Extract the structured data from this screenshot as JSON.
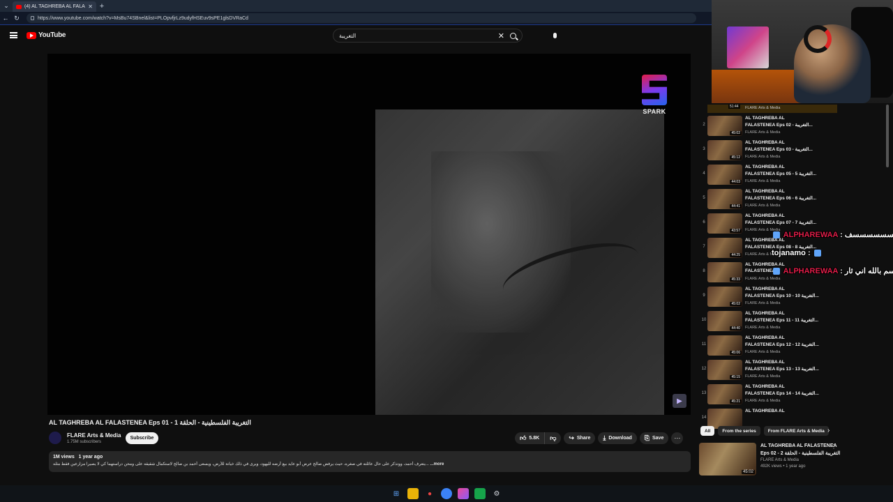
{
  "browser": {
    "tab_title": "(4) AL TAGHREBA AL FALASTENEA",
    "url": "https://www.youtube.com/watch?v=MsBu74SBnel&list=PLOpvfjrLz9udyfHSEuv9sPE1glsDVRaCd"
  },
  "header": {
    "brand": "YouTube",
    "search_query": "التغريبة"
  },
  "video": {
    "spark_label": "SPARK",
    "title": "AL TAGHREBA AL FALASTENEA Eps 01 - التغريبة الفلسطينية - الحلقة 1",
    "channel": "FLARE Arts & Media",
    "subscribers": "1.75M subscribers",
    "subscribe_label": "Subscribe",
    "likes": "5.8K",
    "share_label": "Share",
    "download_label": "Download",
    "save_label": "Save",
    "views": "1M views",
    "age": "1 year ago",
    "description": "يتعرف أحمد، ووتذكر على حال عائلته في صغره، حيث يرفض صالح عرض أبو عايد بيع أرضه لليهود، ويرى في ذلك خيانة للأرض، ويسعى أحمد بن صالح لاستكمال شقيقه على ومحن دراستهما كي لا يصيرا مزارعين فقط مثله...",
    "more_label": "...more"
  },
  "playlist": {
    "current_duration": "51:44",
    "current_channel": "FLARE Arts & Media",
    "items": [
      {
        "index": "2",
        "title1": "AL TAGHREBA AL",
        "title2": "FALASTENEA Eps 02 - التغريبة...",
        "channel": "FLARE Arts & Media",
        "duration": "45:02"
      },
      {
        "index": "3",
        "title1": "AL TAGHREBA AL",
        "title2": "FALASTENEA Eps 03 - التغريبة...",
        "channel": "FLARE Arts & Media",
        "duration": "45:12"
      },
      {
        "index": "4",
        "title1": "AL TAGHREBA AL",
        "title2": "FALASTENEA Eps 05 - 5 التغريبة...",
        "channel": "FLARE Arts & Media",
        "duration": "44:03"
      },
      {
        "index": "5",
        "title1": "AL TAGHREBA AL",
        "title2": "FALASTENEA Eps 06 - 6 التغريبة...",
        "channel": "FLARE Arts & Media",
        "duration": "44:41"
      },
      {
        "index": "6",
        "title1": "AL TAGHREBA AL",
        "title2": "FALASTENEA Eps 07 - 7 التغريبة...",
        "channel": "FLARE Arts & Media",
        "duration": "43:57"
      },
      {
        "index": "7",
        "title1": "AL TAGHREBA AL",
        "title2": "FALASTENEA Eps 08 - 8 التغريبة...",
        "channel": "FLARE Arts & Media",
        "duration": "44:25"
      },
      {
        "index": "8",
        "title1": "AL TAGHREBA AL",
        "title2": "FALASTENEA",
        "channel": "FLARE Arts & Media",
        "duration": "45:33"
      },
      {
        "index": "9",
        "title1": "AL TAGHREBA AL",
        "title2": "FALASTENEA Eps 10 - 10 التغريبة...",
        "channel": "FLARE Arts & Media",
        "duration": "45:02"
      },
      {
        "index": "10",
        "title1": "AL TAGHREBA AL",
        "title2": "FALASTENEA Eps 11 - 11 التغريبة...",
        "channel": "FLARE Arts & Media",
        "duration": "44:40"
      },
      {
        "index": "11",
        "title1": "AL TAGHREBA AL",
        "title2": "FALASTENEA Eps 12 - 12 التغريبة...",
        "channel": "FLARE Arts & Media",
        "duration": "45:06"
      },
      {
        "index": "12",
        "title1": "AL TAGHREBA AL",
        "title2": "FALASTENEA Eps 13 - 13 التغريبة...",
        "channel": "FLARE Arts & Media",
        "duration": "45:15"
      },
      {
        "index": "13",
        "title1": "AL TAGHREBA AL",
        "title2": "FALASTENEA Eps 14 - 14 التغريبة...",
        "channel": "FLARE Arts & Media",
        "duration": "45:21"
      },
      {
        "index": "14",
        "title1": "AL TAGHREBA AL",
        "title2": "",
        "channel": "",
        "duration": ""
      }
    ]
  },
  "chips": {
    "all": "All",
    "series": "From the series",
    "from_channel": "From FLARE Arts & Media"
  },
  "recommendation": {
    "title1": "AL TAGHREBA AL FALASTENEA",
    "title2": "Eps 02 - التغريبة الفلسطينية - الحلقة 2",
    "channel": "FLARE Arts & Media",
    "meta": "492K views • 1 year ago",
    "duration": "45:02"
  },
  "stream_chat": [
    {
      "user": "ALPHAREWAA",
      "msg": "يا الله كيسسسسسسسف"
    },
    {
      "user": "tojanamo",
      "msg": ""
    },
    {
      "user": "ALPHAREWAA",
      "msg": "اقسم بالله اني ثار"
    }
  ],
  "colors": {
    "background": "#0f0f0f",
    "youtube_red": "#ff0000",
    "chat_user": "#e11d48"
  },
  "icons": {
    "search": "search-icon",
    "mic": "mic-icon",
    "like": "thumbs-up-icon",
    "dislike": "thumbs-down-icon",
    "share": "share-icon",
    "download": "download-icon",
    "save": "bookmark-icon"
  }
}
